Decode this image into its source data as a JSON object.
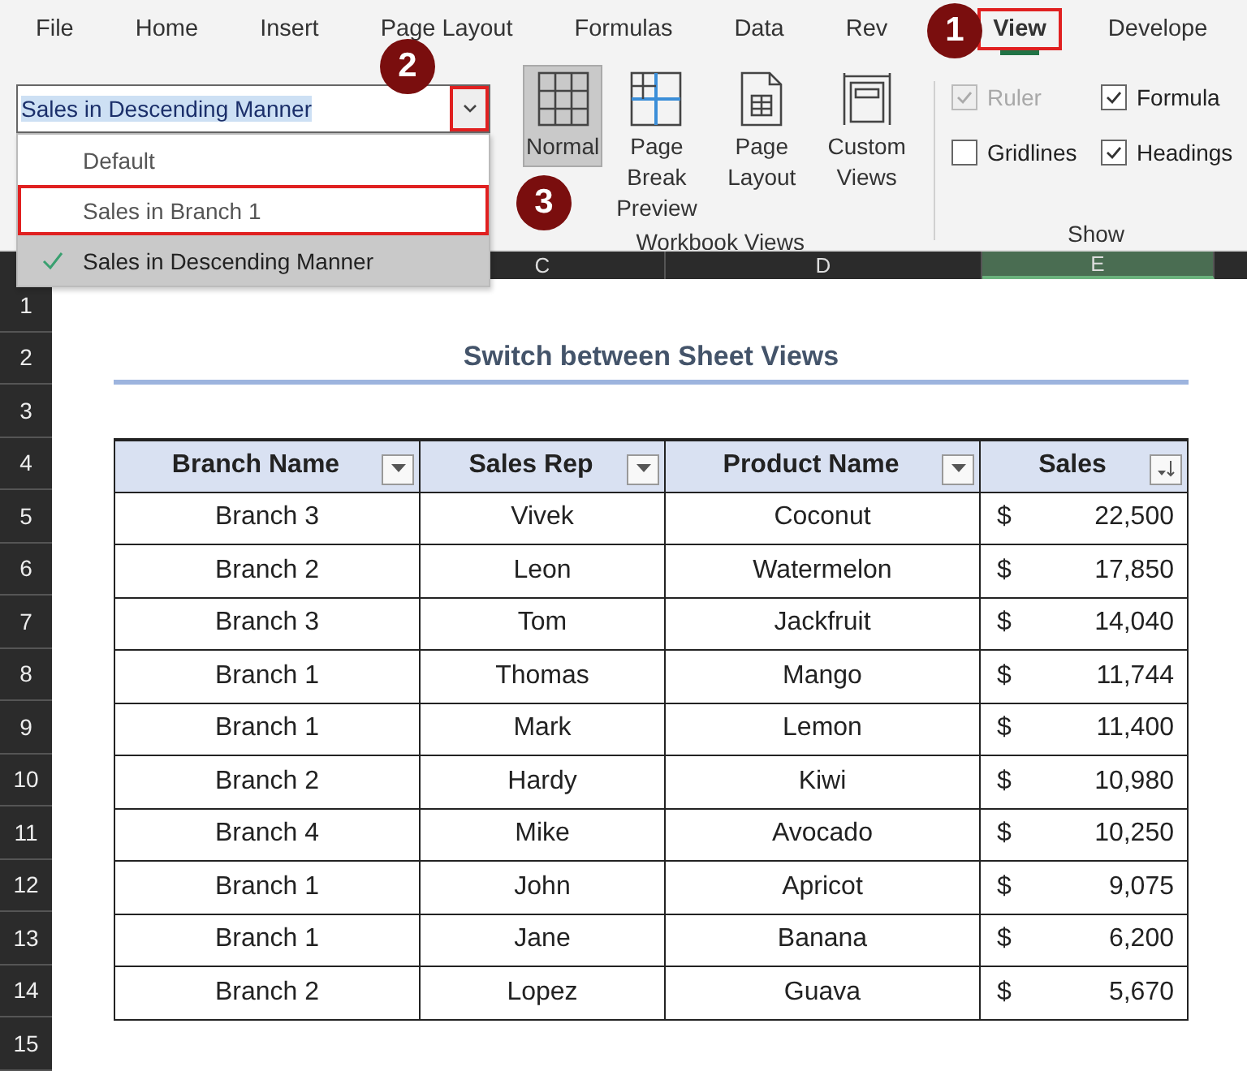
{
  "menu_tabs": [
    {
      "label": "File",
      "selected": false,
      "highlighted": false
    },
    {
      "label": "Home",
      "selected": false,
      "highlighted": false
    },
    {
      "label": "Insert",
      "selected": false,
      "highlighted": false
    },
    {
      "label": "Page Layout",
      "selected": false,
      "highlighted": false
    },
    {
      "label": "Formulas",
      "selected": false,
      "highlighted": false
    },
    {
      "label": "Data",
      "selected": false,
      "highlighted": false
    },
    {
      "label": "Rev",
      "selected": false,
      "highlighted": false
    },
    {
      "label": "View",
      "selected": true,
      "highlighted": true
    },
    {
      "label": "Develope",
      "selected": false,
      "highlighted": false
    }
  ],
  "sheet_view": {
    "value": "Sales in Descending Manner",
    "arrow_highlighted": true,
    "options": [
      {
        "label": "Default",
        "selected": false,
        "highlighted": false
      },
      {
        "label": "Sales in Branch 1",
        "selected": false,
        "highlighted": true
      },
      {
        "label": "Sales in Descending Manner",
        "selected": true,
        "highlighted": false
      }
    ]
  },
  "workbook_views": {
    "label": "Workbook Views",
    "buttons": [
      {
        "kind": "normal",
        "label": "Normal",
        "selected": true
      },
      {
        "kind": "pagebreak",
        "label": "Page Break Preview",
        "selected": false
      },
      {
        "kind": "pagelayout",
        "label": "Page Layout",
        "selected": false
      },
      {
        "kind": "custom",
        "label": "Custom Views",
        "selected": false
      }
    ]
  },
  "show": {
    "label": "Show",
    "options": [
      {
        "label": "Ruler",
        "checked": true,
        "disabled": true
      },
      {
        "label": "Formula",
        "checked": true,
        "disabled": false
      },
      {
        "label": "Gridlines",
        "checked": false,
        "disabled": false
      },
      {
        "label": "Headings",
        "checked": true,
        "disabled": false
      }
    ]
  },
  "callouts": [
    "1",
    "2",
    "3"
  ],
  "column_headers": [
    {
      "label": "C",
      "selected": false
    },
    {
      "label": "D",
      "selected": false
    },
    {
      "label": "E",
      "selected": true
    }
  ],
  "row_numbers": [
    "1",
    "2",
    "3",
    "4",
    "5",
    "6",
    "7",
    "8",
    "9",
    "10",
    "11",
    "12",
    "13",
    "14",
    "15"
  ],
  "sheet": {
    "title": "Switch between Sheet Views",
    "columns": [
      {
        "label": "Branch Name",
        "kind": "filter"
      },
      {
        "label": "Sales Rep",
        "kind": "filter"
      },
      {
        "label": "Product Name",
        "kind": "filter"
      },
      {
        "label": "Sales",
        "kind": "sorted"
      }
    ],
    "rows": [
      [
        "Branch 3",
        "Vivek",
        "Coconut",
        {
          "currency": "$",
          "amount": "22,500"
        }
      ],
      [
        "Branch 2",
        "Leon",
        "Watermelon",
        {
          "currency": "$",
          "amount": "17,850"
        }
      ],
      [
        "Branch 3",
        "Tom",
        "Jackfruit",
        {
          "currency": "$",
          "amount": "14,040"
        }
      ],
      [
        "Branch 1",
        "Thomas",
        "Mango",
        {
          "currency": "$",
          "amount": "11,744"
        }
      ],
      [
        "Branch 1",
        "Mark",
        "Lemon",
        {
          "currency": "$",
          "amount": "11,400"
        }
      ],
      [
        "Branch 2",
        "Hardy",
        "Kiwi",
        {
          "currency": "$",
          "amount": "10,980"
        }
      ],
      [
        "Branch 4",
        "Mike",
        "Avocado",
        {
          "currency": "$",
          "amount": "10,250"
        }
      ],
      [
        "Branch 1",
        "John",
        "Apricot",
        {
          "currency": "$",
          "amount": "9,075"
        }
      ],
      [
        "Branch 1",
        "Jane",
        "Banana",
        {
          "currency": "$",
          "amount": "6,200"
        }
      ],
      [
        "Branch 2",
        "Lopez",
        "Guava",
        {
          "currency": "$",
          "amount": "5,670"
        }
      ]
    ]
  }
}
